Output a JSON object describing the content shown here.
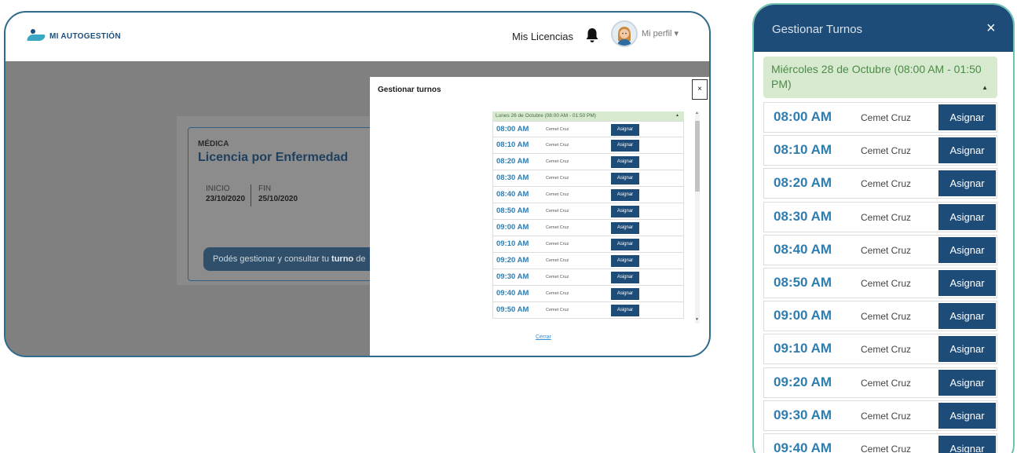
{
  "desktop": {
    "header": {
      "logo_text": "MI AUTOGESTIÓN",
      "nav_link": "Mis Licencias",
      "profile_label": "Mi perfil ▾"
    },
    "license_card": {
      "type": "MÉDICA",
      "title": "Licencia por Enfermedad",
      "start_label": "INICIO",
      "start_date": "23/10/2020",
      "end_label": "FIN",
      "end_date": "25/10/2020",
      "info_prefix": "Podés gestionar y consultar tu ",
      "info_bold": "turno",
      "info_suffix": " de"
    },
    "modal": {
      "title": "Gestionar turnos",
      "close_label": "×",
      "group_label": "Lunes 26 de Octubre (08:00 AM - 01:50 PM)",
      "group_caret": "▲",
      "close_link": "Cerrar",
      "slots": [
        {
          "time": "08:00 AM",
          "provider": "Cemet Cruz",
          "button": "Asignar"
        },
        {
          "time": "08:10 AM",
          "provider": "Cemet Cruz",
          "button": "Asignar"
        },
        {
          "time": "08:20 AM",
          "provider": "Cemet Cruz",
          "button": "Asignar"
        },
        {
          "time": "08:30 AM",
          "provider": "Cemet Cruz",
          "button": "Asignar"
        },
        {
          "time": "08:40 AM",
          "provider": "Cemet Cruz",
          "button": "Asignar"
        },
        {
          "time": "08:50 AM",
          "provider": "Cemet Cruz",
          "button": "Asignar"
        },
        {
          "time": "09:00 AM",
          "provider": "Cemet Cruz",
          "button": "Asignar"
        },
        {
          "time": "09:10 AM",
          "provider": "Cemet Cruz",
          "button": "Asignar"
        },
        {
          "time": "09:20 AM",
          "provider": "Cemet Cruz",
          "button": "Asignar"
        },
        {
          "time": "09:30 AM",
          "provider": "Cemet Cruz",
          "button": "Asignar"
        },
        {
          "time": "09:40 AM",
          "provider": "Cemet Cruz",
          "button": "Asignar"
        },
        {
          "time": "09:50 AM",
          "provider": "Cemet Cruz",
          "button": "Asignar"
        }
      ]
    }
  },
  "mobile": {
    "title": "Gestionar Turnos",
    "close_label": "×",
    "group_label": "Miércoles 28 de Octubre (08:00 AM - 01:50 PM)",
    "group_caret": "▲",
    "slots": [
      {
        "time": "08:00 AM",
        "provider": "Cemet Cruz",
        "button": "Asignar"
      },
      {
        "time": "08:10 AM",
        "provider": "Cemet Cruz",
        "button": "Asignar"
      },
      {
        "time": "08:20 AM",
        "provider": "Cemet Cruz",
        "button": "Asignar"
      },
      {
        "time": "08:30 AM",
        "provider": "Cemet Cruz",
        "button": "Asignar"
      },
      {
        "time": "08:40 AM",
        "provider": "Cemet Cruz",
        "button": "Asignar"
      },
      {
        "time": "08:50 AM",
        "provider": "Cemet Cruz",
        "button": "Asignar"
      },
      {
        "time": "09:00 AM",
        "provider": "Cemet Cruz",
        "button": "Asignar"
      },
      {
        "time": "09:10 AM",
        "provider": "Cemet Cruz",
        "button": "Asignar"
      },
      {
        "time": "09:20 AM",
        "provider": "Cemet Cruz",
        "button": "Asignar"
      },
      {
        "time": "09:30 AM",
        "provider": "Cemet Cruz",
        "button": "Asignar"
      },
      {
        "time": "09:40 AM",
        "provider": "Cemet Cruz",
        "button": "Asignar"
      }
    ]
  },
  "colors": {
    "primary": "#1d4c79",
    "time_blue": "#2e7db0",
    "group_green": "#d7eacf",
    "frame_teal": "#6dc2b0"
  }
}
